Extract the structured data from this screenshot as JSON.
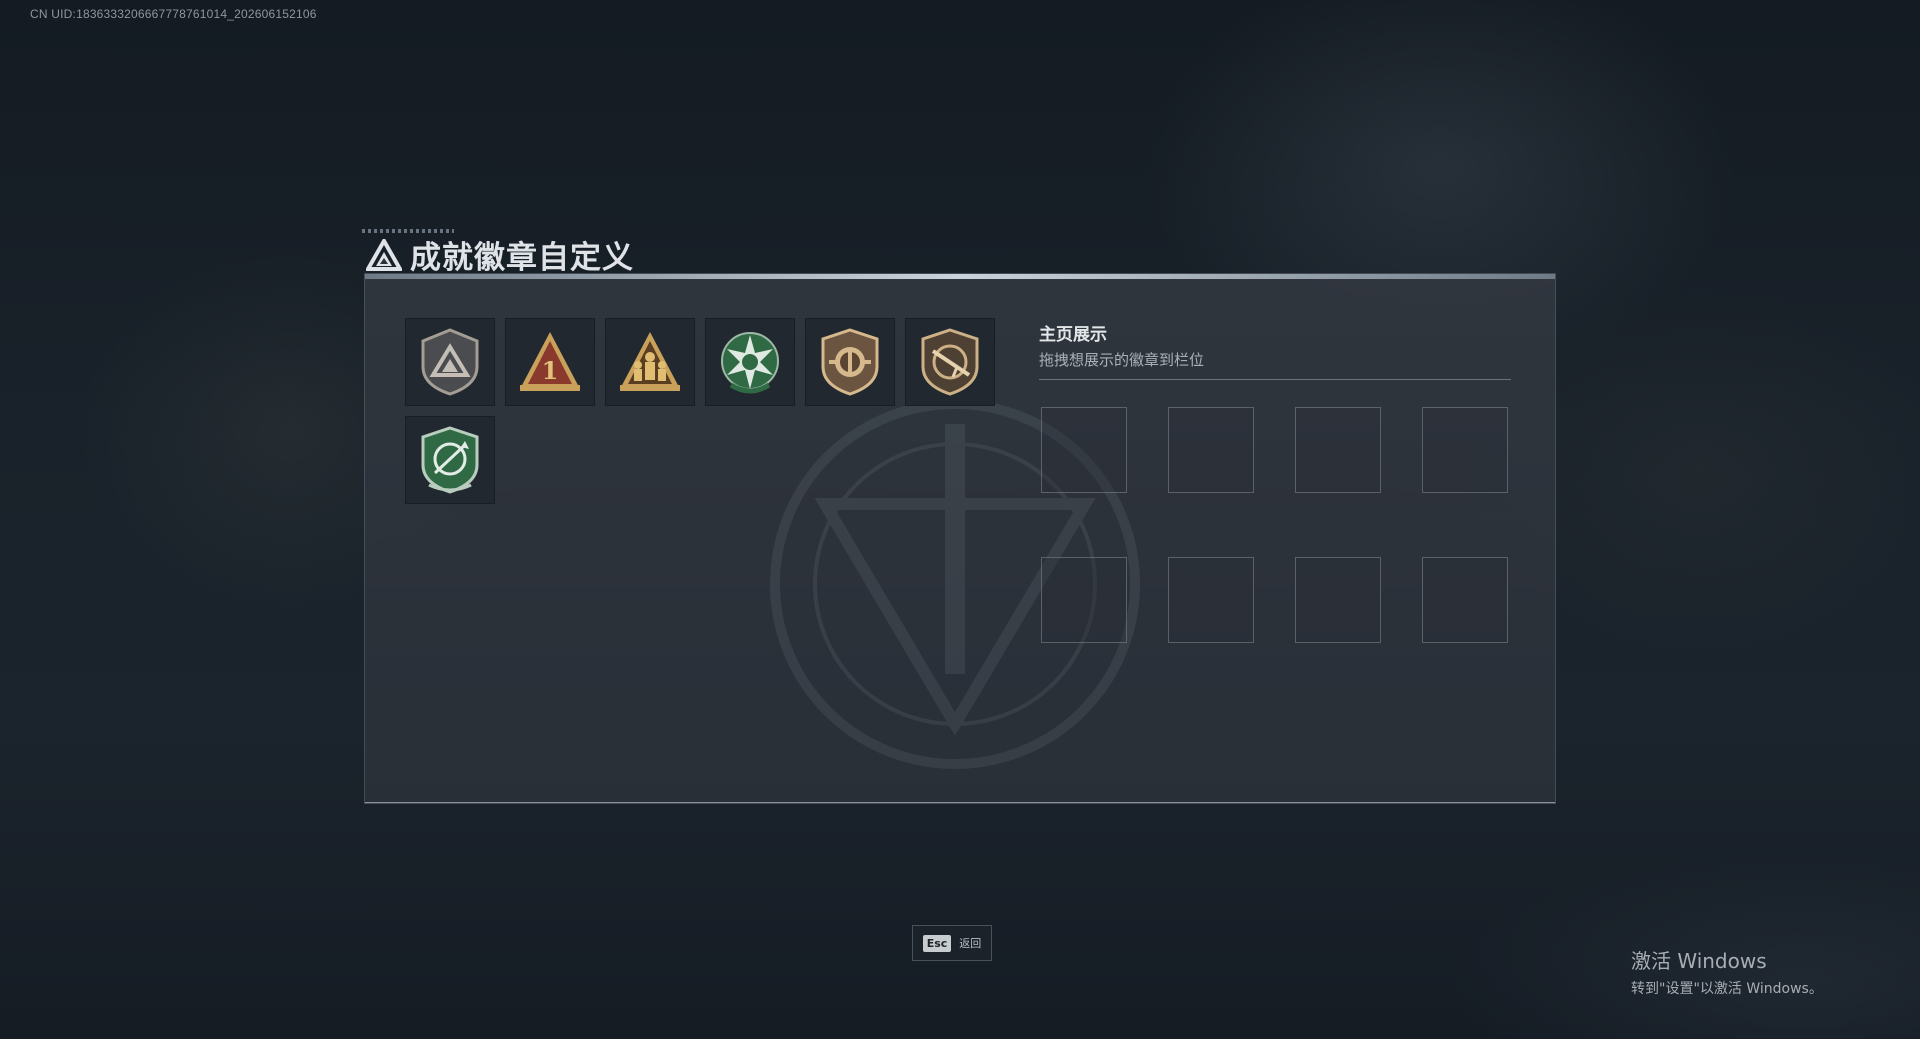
{
  "uid_text": "CN UID:1836333206667778761014_202606152106",
  "title": {
    "icon": "triangle-logo-icon",
    "text": "成就徽章自定义"
  },
  "badges": [
    {
      "icon": "gray-shield-triangle-badge-icon"
    },
    {
      "icon": "red-triangle-number-one-badge-icon"
    },
    {
      "icon": "gold-triangle-soldiers-badge-icon"
    },
    {
      "icon": "green-star-emblem-badge-icon"
    },
    {
      "icon": "bronze-shield-emblem-badge-icon"
    },
    {
      "icon": "bronze-shield-rifle-badge-icon"
    },
    {
      "icon": "green-shield-crossed-arrows-badge-icon"
    }
  ],
  "showcase": {
    "title": "主页展示",
    "subtitle": "拖拽想展示的徽章到栏位",
    "slot_count": 8
  },
  "esc": {
    "key": "Esc",
    "label": "返回"
  },
  "activation": {
    "title": "激活 Windows",
    "subtitle": "转到\"设置\"以激活 Windows。"
  },
  "colors": {
    "background": "#19212a",
    "panel": "#323840",
    "badge_gold": "#c9a15a",
    "badge_red": "#8a3a2c",
    "badge_green": "#2f6a45"
  }
}
